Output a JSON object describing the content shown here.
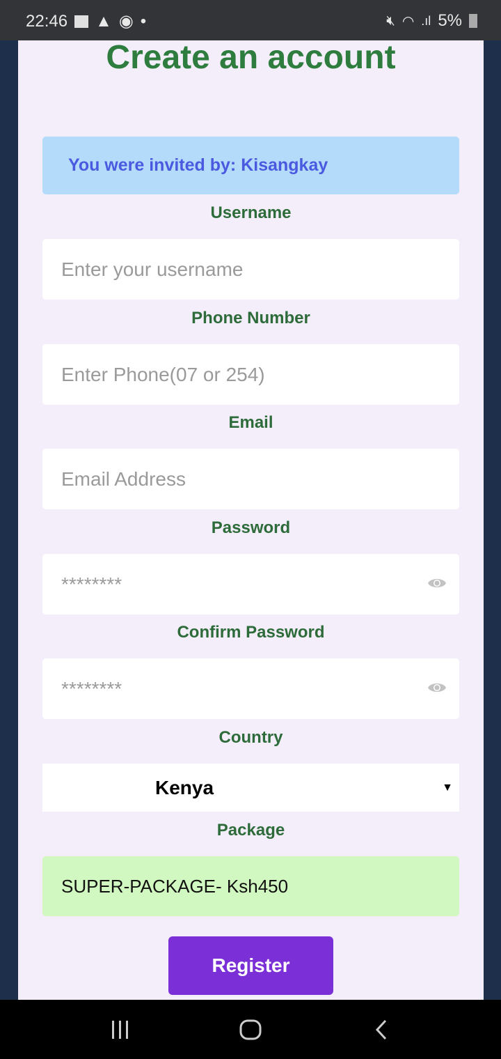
{
  "status_bar": {
    "time": "22:46",
    "battery": "5%"
  },
  "form": {
    "title": "Create an account",
    "invite_prefix": "You were invited by: ",
    "invite_name": "Kisangkay",
    "fields": [
      {
        "label": "Username",
        "placeholder": "Enter your username"
      },
      {
        "label": "Phone Number",
        "placeholder": "Enter Phone(07 or 254)"
      },
      {
        "label": "Email",
        "placeholder": "Email Address"
      },
      {
        "label": "Password",
        "placeholder": "********"
      },
      {
        "label": "Confirm Password",
        "placeholder": "********"
      }
    ],
    "country_label": "Country",
    "country_value": "Kenya",
    "package_label": "Package",
    "package_value": "SUPER-PACKAGE- Ksh450",
    "register_label": "Register"
  },
  "colors": {
    "accent": "#7b2fd6",
    "label_green": "#2e6b3a",
    "invite_bg": "#b5dbfb",
    "package_bg": "#d1f8c0"
  }
}
